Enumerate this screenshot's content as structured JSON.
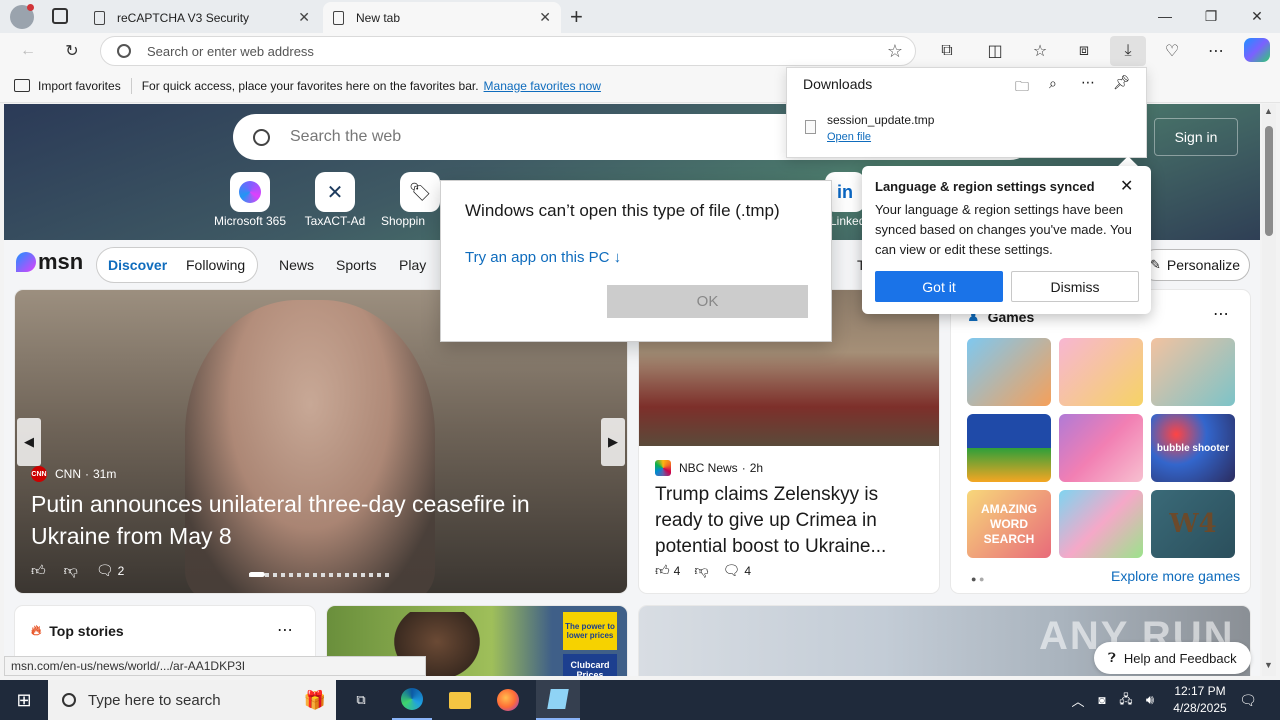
{
  "tabs": [
    {
      "title": "reCAPTCHA V3 Security"
    },
    {
      "title": "New tab"
    }
  ],
  "address": {
    "placeholder": "Search or enter web address"
  },
  "favorites": {
    "import_label": "Import favorites",
    "hint": "For quick access, place your favorites here on the favorites bar.",
    "manage_link": "Manage favorites now"
  },
  "hero": {
    "search_placeholder": "Search the web",
    "sign_in": "Sign in",
    "tiles": [
      "Microsoft 365",
      "TaxACT-Ad",
      "Shoppin",
      "LinkedIn"
    ]
  },
  "msn": {
    "logo": "msn",
    "pills": [
      "Discover",
      "Following"
    ],
    "nav": [
      "News",
      "Sports",
      "Play",
      "T"
    ],
    "personalize": "Personalize"
  },
  "main_story": {
    "source": "CNN",
    "time": "31m",
    "headline": "Putin announces unilateral three-day ceasefire in Ukraine from May 8",
    "comments": "2"
  },
  "side_story": {
    "source": "NBC News",
    "time": "2h",
    "headline": "Trump claims Zelenskyy is ready to give up Crimea in potential boost to Ukraine...",
    "likes": "4",
    "comments": "4"
  },
  "games": {
    "title": "Games",
    "explore": "Explore more games",
    "tiles": [
      "bubble shooter",
      "AMAZING WORD SEARCH",
      "W4"
    ]
  },
  "top_stories": {
    "title": "Top stories"
  },
  "ad": {
    "line1": "The power to lower prices",
    "line2": "Clubcard Prices"
  },
  "downloads": {
    "title": "Downloads",
    "file_name": "session_update.tmp",
    "open_file": "Open file"
  },
  "dialog": {
    "message": "Windows can’t open this type of file (.tmp)",
    "link": "Try an app on this PC ↓",
    "ok": "OK"
  },
  "sync_popup": {
    "title": "Language & region settings synced",
    "body": "Your language & region settings have been synced based on changes you've made. You can view or edit these settings.",
    "got_it": "Got it",
    "dismiss": "Dismiss"
  },
  "help": "Help and Feedback",
  "status_url": "msn.com/en-us/news/world/.../ar-AA1DKP3I",
  "taskbar": {
    "search_placeholder": "Type here to search",
    "time": "12:17 PM",
    "date": "4/28/2025"
  },
  "watermark": "ANY RUN",
  "colors": {
    "accent": "#0f6cbd",
    "got_it": "#1a73e8",
    "taskbar": "#1f2a3b"
  }
}
